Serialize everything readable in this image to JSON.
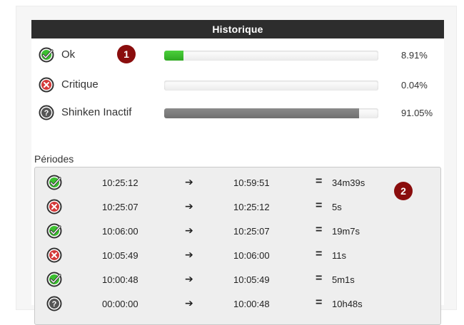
{
  "panel": {
    "title": "Historique"
  },
  "states": [
    {
      "label": "Ok",
      "percent_text": "8.91%",
      "fraction": 0.0891,
      "status": "ok",
      "icon": "check-circle-icon"
    },
    {
      "label": "Critique",
      "percent_text": "0.04%",
      "fraction": 0.0004,
      "status": "critical",
      "icon": "x-circle-icon"
    },
    {
      "label": "Shinken Inactif",
      "percent_text": "91.05%",
      "fraction": 0.9105,
      "status": "inactive",
      "icon": "question-circle-icon"
    }
  ],
  "badges": {
    "first": "1",
    "second": "2"
  },
  "periods": {
    "title": "Périodes",
    "arrow": "➔",
    "equals": "=",
    "rows": [
      {
        "status": "ok",
        "icon": "check-circle-icon",
        "start": "10:25:12",
        "end": "10:59:51",
        "duration": "34m39s"
      },
      {
        "status": "critical",
        "icon": "x-circle-icon",
        "start": "10:25:07",
        "end": "10:25:12",
        "duration": "5s"
      },
      {
        "status": "ok",
        "icon": "check-circle-icon",
        "start": "10:06:00",
        "end": "10:25:07",
        "duration": "19m7s"
      },
      {
        "status": "critical",
        "icon": "x-circle-icon",
        "start": "10:05:49",
        "end": "10:06:00",
        "duration": "11s"
      },
      {
        "status": "ok",
        "icon": "check-circle-icon",
        "start": "10:00:48",
        "end": "10:05:49",
        "duration": "5m1s"
      },
      {
        "status": "inactive",
        "icon": "question-circle-icon",
        "start": "00:00:00",
        "end": "10:00:48",
        "duration": "10h48s"
      }
    ]
  },
  "colors": {
    "ok": "#3bbf2f",
    "critical": "#d43a3a",
    "inactive": "#555555",
    "header": "#2d2d2d",
    "badge": "#8a0d0d"
  }
}
